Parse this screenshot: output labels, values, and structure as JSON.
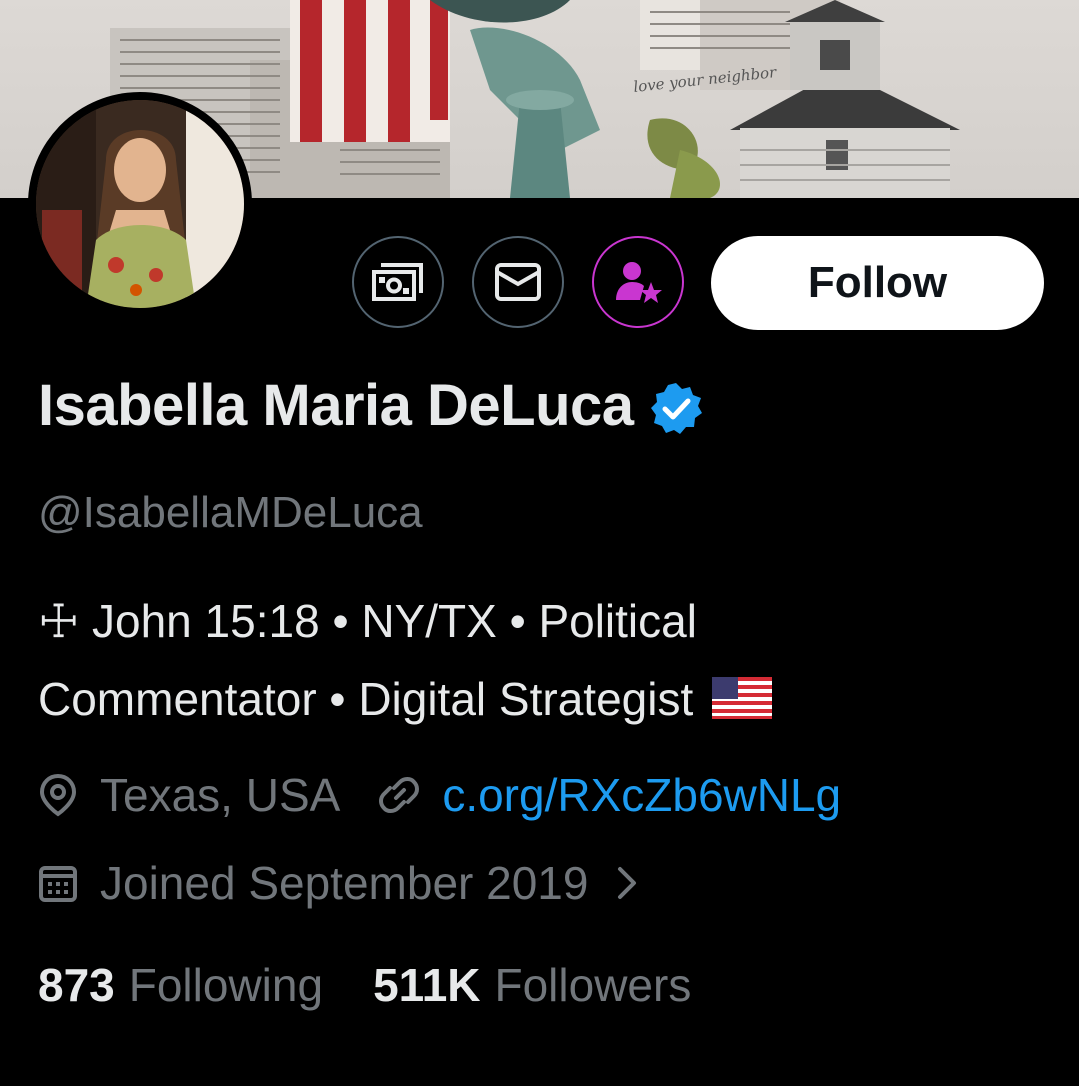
{
  "profile": {
    "display_name": "Isabella Maria DeLuca",
    "handle": "@IsabellaMDeLuca",
    "bio_line1": "☩ John 15:18 • NY/TX • Political",
    "bio_line2": "Commentator • Digital Strategist",
    "location": "Texas, USA",
    "website": "c.org/RXcZb6wNLg",
    "joined": "Joined September 2019"
  },
  "banner": {
    "script_text": "love your neighbor"
  },
  "actions": {
    "follow_label": "Follow"
  },
  "stats": {
    "following_count": "873",
    "following_label": "Following",
    "followers_count": "511K",
    "followers_label": "Followers"
  },
  "colors": {
    "accent_blue": "#1d9bf0",
    "muted_text": "#71767b",
    "subscribe_purple": "#c936d0"
  },
  "icons": [
    "tip-icon",
    "mail-icon",
    "subscribe-icon",
    "verified-badge-icon",
    "location-icon",
    "link-icon",
    "calendar-icon",
    "chevron-right-icon",
    "us-flag-emoji"
  ]
}
